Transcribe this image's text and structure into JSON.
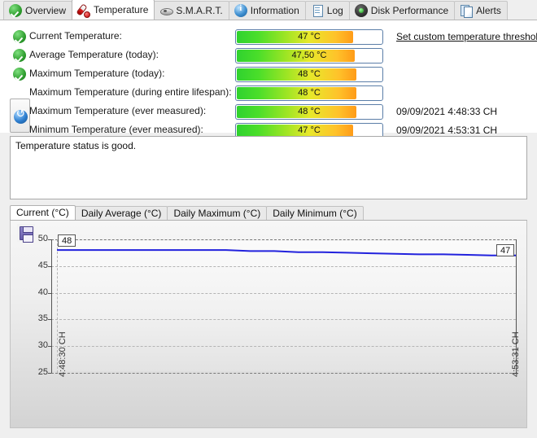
{
  "window": {
    "title": "Temperature"
  },
  "tabs": [
    {
      "label": "Overview",
      "icon": "check-circle-icon",
      "selected": false
    },
    {
      "label": "Temperature",
      "icon": "thermometer-icon",
      "selected": true
    },
    {
      "label": "S.M.A.R.T.",
      "icon": "disk-platter-icon",
      "selected": false
    },
    {
      "label": "Information",
      "icon": "information-icon",
      "selected": false
    },
    {
      "label": "Log",
      "icon": "document-icon",
      "selected": false
    },
    {
      "label": "Disk Performance",
      "icon": "gauge-icon",
      "selected": false
    },
    {
      "label": "Alerts",
      "icon": "copy-pages-icon",
      "selected": false
    }
  ],
  "temperature_rows": [
    {
      "label": "Current Temperature:",
      "value": "47 °C",
      "percent": 47,
      "status": "ok",
      "timestamp": ""
    },
    {
      "label": "Average Temperature (today):",
      "value": "47,50 °C",
      "percent": 47.5,
      "status": "ok",
      "timestamp": ""
    },
    {
      "label": "Maximum Temperature (today):",
      "value": "48 °C",
      "percent": 48,
      "status": "ok",
      "timestamp": ""
    },
    {
      "label": "Maximum Temperature (during entire lifespan):",
      "value": "48 °C",
      "percent": 48,
      "status": "none",
      "timestamp": ""
    },
    {
      "label": "Maximum Temperature (ever measured):",
      "value": "48 °C",
      "percent": 48,
      "status": "none",
      "timestamp": "09/09/2021 4:48:33 CH"
    },
    {
      "label": "Minimum Temperature (ever measured):",
      "value": "47 °C",
      "percent": 47,
      "status": "none",
      "timestamp": "09/09/2021 4:53:31 CH"
    }
  ],
  "threshold_link": {
    "label": "Set custom temperature threshold"
  },
  "reset_button": {
    "icon": "reset-arrow-icon"
  },
  "status_box": {
    "text": "Temperature status is good."
  },
  "chart_tabs": [
    {
      "label": "Current (°C)",
      "selected": true
    },
    {
      "label": "Daily Average (°C)",
      "selected": false
    },
    {
      "label": "Daily Maximum (°C)",
      "selected": false
    },
    {
      "label": "Daily Minimum (°C)",
      "selected": false
    }
  ],
  "save_button": {
    "icon": "floppy-save-icon"
  },
  "chart_data": {
    "type": "line",
    "title": "",
    "xlabel": "",
    "ylabel": "",
    "ylim": [
      25,
      50
    ],
    "yticks": [
      25,
      30,
      35,
      40,
      45,
      50
    ],
    "ytick_labels": [
      "25",
      "30",
      "35",
      "40",
      "45",
      "50"
    ],
    "grid": true,
    "legend": false,
    "line_color": "#2222dd",
    "xtick_labels": [
      "4:48:30 CH",
      "4:53:31 CH"
    ],
    "start_callout": "48",
    "end_callout": "47",
    "x": [
      0,
      1,
      2,
      3,
      4,
      5,
      6,
      7,
      8,
      9,
      10,
      11,
      12,
      13,
      14,
      15,
      16,
      17,
      18,
      19
    ],
    "values": [
      48,
      48,
      48,
      48,
      48,
      48,
      48,
      48,
      47.8,
      47.8,
      47.6,
      47.6,
      47.5,
      47.4,
      47.3,
      47.2,
      47.2,
      47.1,
      47.0,
      47.0
    ],
    "series": [
      {
        "name": "Current (°C)",
        "values": [
          48,
          48,
          48,
          48,
          48,
          48,
          48,
          48,
          47.8,
          47.8,
          47.6,
          47.6,
          47.5,
          47.4,
          47.3,
          47.2,
          47.2,
          47.1,
          47.0,
          47.0
        ]
      }
    ]
  },
  "colors": {
    "bar_start": "#2fd22f",
    "bar_end": "#ff9b18",
    "chart_line": "#2222dd",
    "tab_selected_bg": "#ffffff"
  }
}
